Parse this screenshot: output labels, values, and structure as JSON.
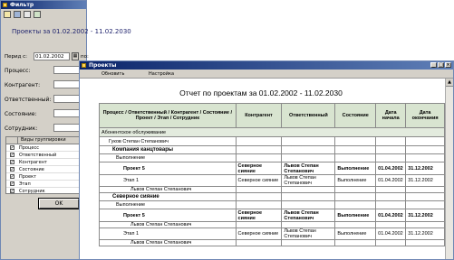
{
  "filter_window": {
    "title": "Фильтр",
    "heading": "Проекты за 01.02.2002 - 11.02.2030",
    "period_label": "Перид с:",
    "date_from": "01.02.2002",
    "date_to_label": "по:",
    "date_to": "11.02.2030",
    "field_labels": [
      "Процесс:",
      "Контрагент:",
      "Ответственный:",
      "Состояние:",
      "Сотрудник:"
    ],
    "grouping_header": "Виды группировки",
    "groupings": [
      "Процесс",
      "Ответственный",
      "Контрагент",
      "Состояние",
      "Проект",
      "Этап",
      "Сотрудник"
    ],
    "ok_button": "OK"
  },
  "report_window": {
    "title": "Проекты",
    "toolbar": {
      "refresh": "Обновить",
      "settings": "Настройка"
    },
    "report_title": "Отчет по проектам за 01.02.2002 - 11.02.2030",
    "headers": {
      "col1": "Процесс / Ответственный / Контрагент / Состояние / Проект / Этап / Сотрудник",
      "col2": "Контрагент",
      "col3": "Ответственный",
      "col4": "Состояние",
      "col5": "Дата начала",
      "col6": "Дата окончания"
    },
    "rows": [
      {
        "kind": "group",
        "c1": "Абонентское обслуживание"
      },
      {
        "kind": "l1",
        "c1": "Гуков Степан Степанович"
      },
      {
        "kind": "l2",
        "c1": "Компания канцтовары"
      },
      {
        "kind": "l3",
        "c1": "Выполнение"
      },
      {
        "kind": "project",
        "c1": "Проект 5",
        "c2": "Северное сияние",
        "c3": "Львов Степан Степанович",
        "c4": "Выполнение",
        "c5": "01.04.2002",
        "c6": "31.12.2002"
      },
      {
        "kind": "stage",
        "c1": "Этап 1",
        "c2": "Северное сияние",
        "c3": "Львов Степан Степанович",
        "c4": "Выполнение",
        "c5": "01.04.2002",
        "c6": "31.12.2002"
      },
      {
        "kind": "emp",
        "c1": "Львов Степан Степанович"
      },
      {
        "kind": "l2",
        "c1": "Северное сияние"
      },
      {
        "kind": "l3",
        "c1": "Выполнение"
      },
      {
        "kind": "project",
        "c1": "Проект 5",
        "c2": "Северное сияние",
        "c3": "Львов Степан Степанович",
        "c4": "Выполнение",
        "c5": "01.04.2002",
        "c6": "31.12.2002"
      },
      {
        "kind": "emp",
        "c1": "Львов Степан Степанович"
      },
      {
        "kind": "stage",
        "c1": "Этап 1",
        "c2": "Северное сияние",
        "c3": "Львов Степан Степанович",
        "c4": "Выполнение",
        "c5": "01.04.2002",
        "c6": "31.12.2002"
      },
      {
        "kind": "emp",
        "c1": "Львов Степан Степанович"
      }
    ]
  }
}
